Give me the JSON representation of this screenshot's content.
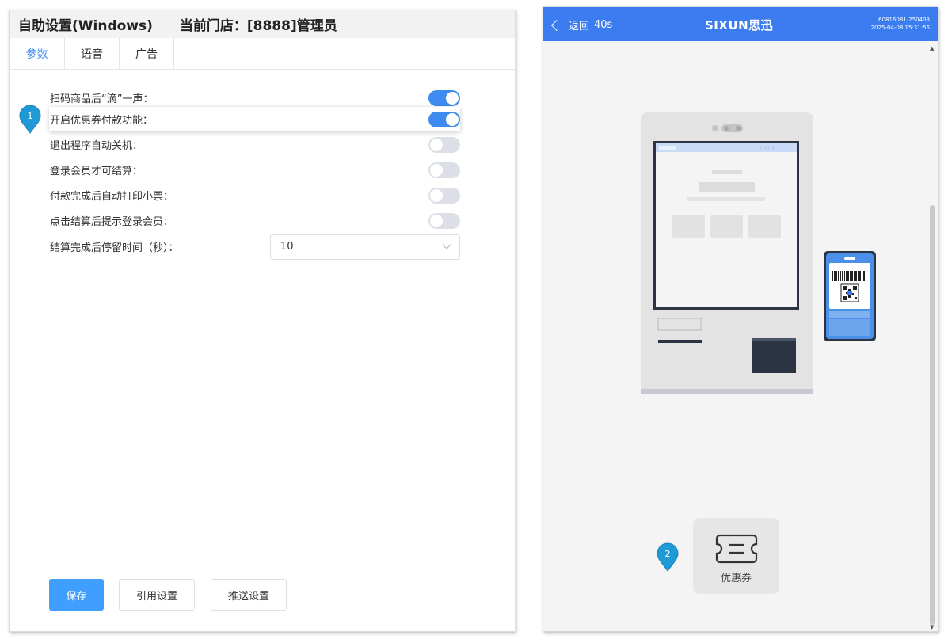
{
  "settings_window": {
    "title": "自助设置(Windows)",
    "store": "当前门店：[8888]管理员",
    "tabs": [
      "参数",
      "语音",
      "广告"
    ],
    "active_tab": "参数",
    "rows": [
      {
        "label": "扫码商品后“滴”一声：",
        "on": true
      },
      {
        "label": "开启优惠券付款功能：",
        "on": true
      },
      {
        "label": "退出程序自动关机：",
        "on": false
      },
      {
        "label": "登录会员才可结算：",
        "on": false
      },
      {
        "label": "付款完成后自动打印小票：",
        "on": false
      },
      {
        "label": "点击结算后提示登录会员：",
        "on": false
      }
    ],
    "stay_time": {
      "label": "结算完成后停留时间（秒）：",
      "value": "10"
    },
    "buttons": {
      "save": "保存",
      "ref": "引用设置",
      "push": "推送设置"
    },
    "marker1": "1",
    "colors": {
      "accent": "#3f8cf0",
      "primary_button": "#409efe",
      "marker": "#1f9ad6"
    }
  },
  "kiosk": {
    "back_label": "返回",
    "countdown": "40s",
    "logo": "SIXUN思迅",
    "device_id": "60816081-250403",
    "datetime": "2025-04-08 15:31:56",
    "coupon_label": "优惠券",
    "marker2": "2",
    "colors": {
      "topbar": "#3b7cf0",
      "background": "#f4f4f4"
    }
  }
}
